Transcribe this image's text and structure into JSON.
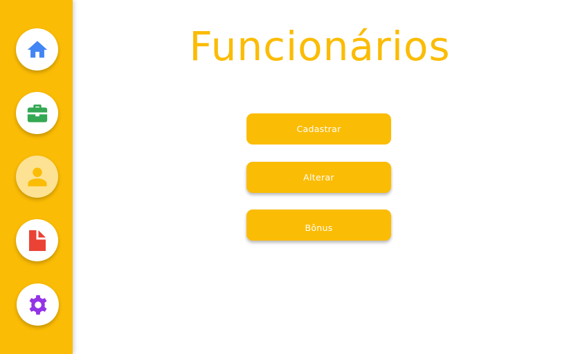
{
  "colors": {
    "brand_yellow": "#FBBC05",
    "nav_bg": "#FFFFFF",
    "nav_active_bg": "#FDE293",
    "home_icon": "#4285F4",
    "briefcase_icon": "#34A853",
    "user_icon": "#FBBC05",
    "document_icon": "#EA4335",
    "gear_icon": "#9334E6",
    "button_text": "#FFFFFF"
  },
  "sidebar": {
    "items": [
      {
        "id": "home",
        "icon": "home-icon",
        "active": false
      },
      {
        "id": "jobs",
        "icon": "briefcase-icon",
        "active": false
      },
      {
        "id": "employees",
        "icon": "user-icon",
        "active": true
      },
      {
        "id": "reports",
        "icon": "document-icon",
        "active": false
      },
      {
        "id": "settings",
        "icon": "gear-icon",
        "active": false
      }
    ]
  },
  "main": {
    "title": "Funcionários",
    "buttons": {
      "cadastrar": "Cadastrar",
      "alterar": "Alterar",
      "bonus": "Bônus"
    }
  }
}
